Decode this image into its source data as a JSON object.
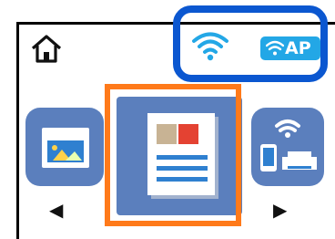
{
  "header": {
    "home_icon": "home-icon",
    "wifi_icon": "wifi-icon",
    "ap_badge_icon": "wifi-ap-icon",
    "ap_label": "AP",
    "highlight_color": "#0b57d0"
  },
  "menu": {
    "tiles": [
      {
        "name": "photo-scan-tile",
        "icon": "photo-icon"
      },
      {
        "name": "document-tile",
        "icon": "document-icon"
      },
      {
        "name": "wireless-devices-tile",
        "icon": "wireless-printer-icon"
      }
    ],
    "selected_index": 1,
    "selection_color": "#ff7a1a",
    "tile_color": "#5b7fbd"
  },
  "nav": {
    "left_arrow": "◀",
    "right_arrow": "▶"
  }
}
